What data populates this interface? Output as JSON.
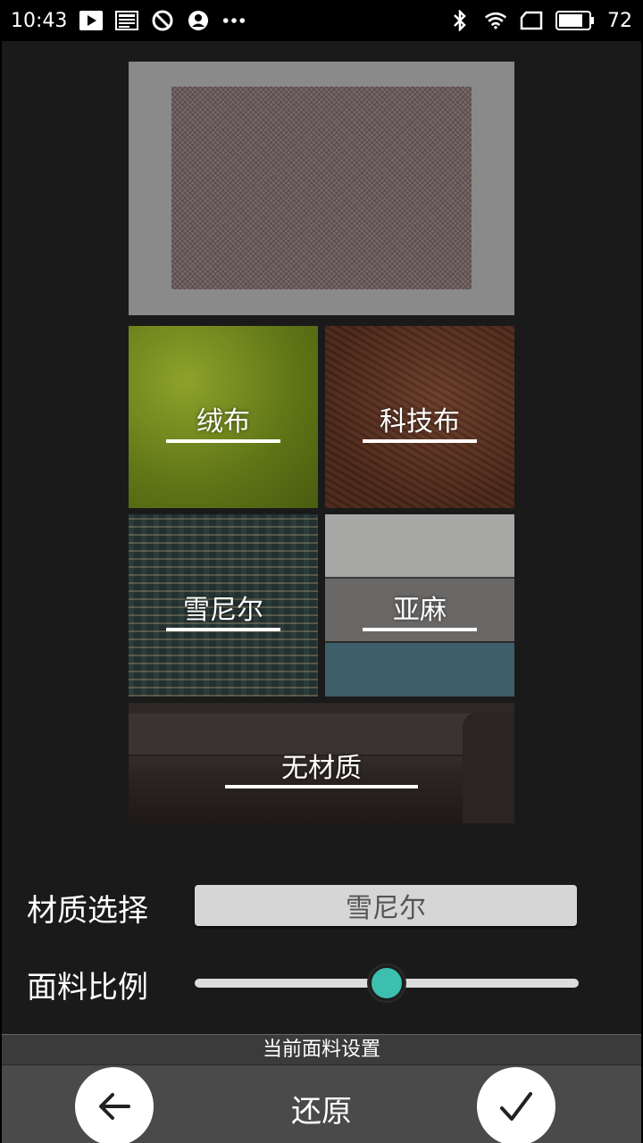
{
  "status_bar": {
    "time": "10:43",
    "battery_level": "72",
    "icons_left": [
      "play-icon",
      "news-icon",
      "do-not-disturb-icon",
      "account-icon",
      "more-dots-icon"
    ],
    "icons_right": [
      "bluetooth-icon",
      "wifi-icon",
      "sim-card-icon",
      "battery-icon"
    ]
  },
  "materials": {
    "velvet": "绒布",
    "tech_fabric": "科技布",
    "chenille": "雪尼尔",
    "linen": "亚麻",
    "none": "无材质"
  },
  "controls": {
    "material_select_label": "材质选择",
    "material_select_value": "雪尼尔",
    "fabric_ratio_label": "面料比例",
    "fabric_ratio_value": 0.5
  },
  "footer": {
    "title": "当前面料设置",
    "reset_label": "还原",
    "back_icon": "arrow-left-icon",
    "confirm_icon": "check-icon"
  }
}
